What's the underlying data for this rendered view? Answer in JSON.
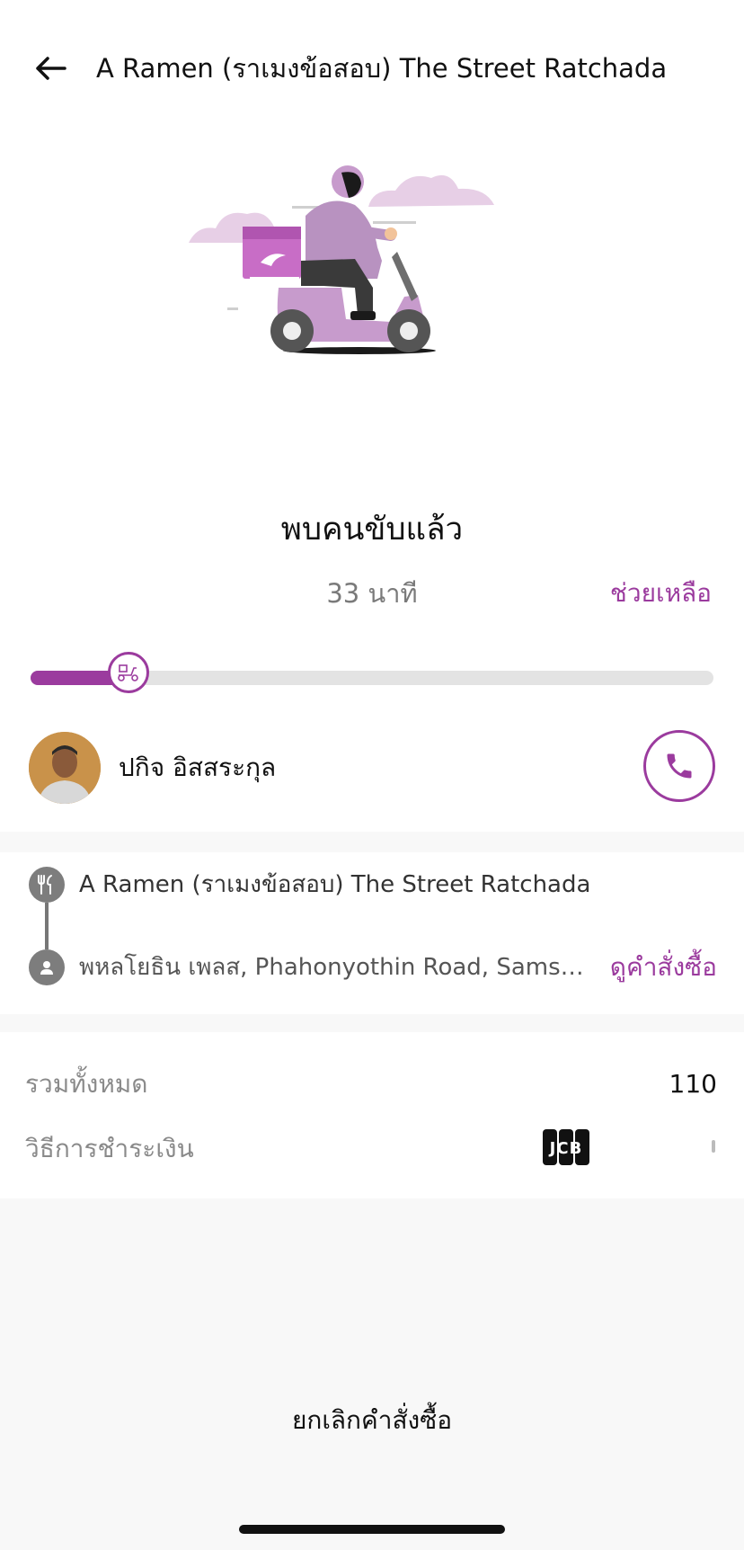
{
  "header": {
    "title": "A Ramen (ราเมงข้อสอบ) The Street Ratchada"
  },
  "status": {
    "title": "พบคนขับแล้ว",
    "eta": "33 นาที",
    "help_label": "ช่วยเหลือ",
    "progress_fraction": 0.14
  },
  "driver": {
    "name": "ปกิจ อิสสระกุล"
  },
  "route": {
    "pickup": "A Ramen (ราเมงข้อสอบ) The Street Ratchada",
    "dropoff": "พหลโยธิน เพลส, Phahonyothin Road, Samse...",
    "view_order_label": "ดูคำสั่งซื้อ"
  },
  "summary": {
    "total_label": "รวมทั้งหมด",
    "total_value": "110",
    "payment_label": "วิธีการชำระเงิน",
    "payment_icon": "jcb-card-icon"
  },
  "actions": {
    "cancel_label": "ยกเลิกคำสั่งซื้อ"
  },
  "colors": {
    "accent": "#9b3b9e",
    "track": "#e3e3e3",
    "page_bg": "#f8f8f8"
  }
}
